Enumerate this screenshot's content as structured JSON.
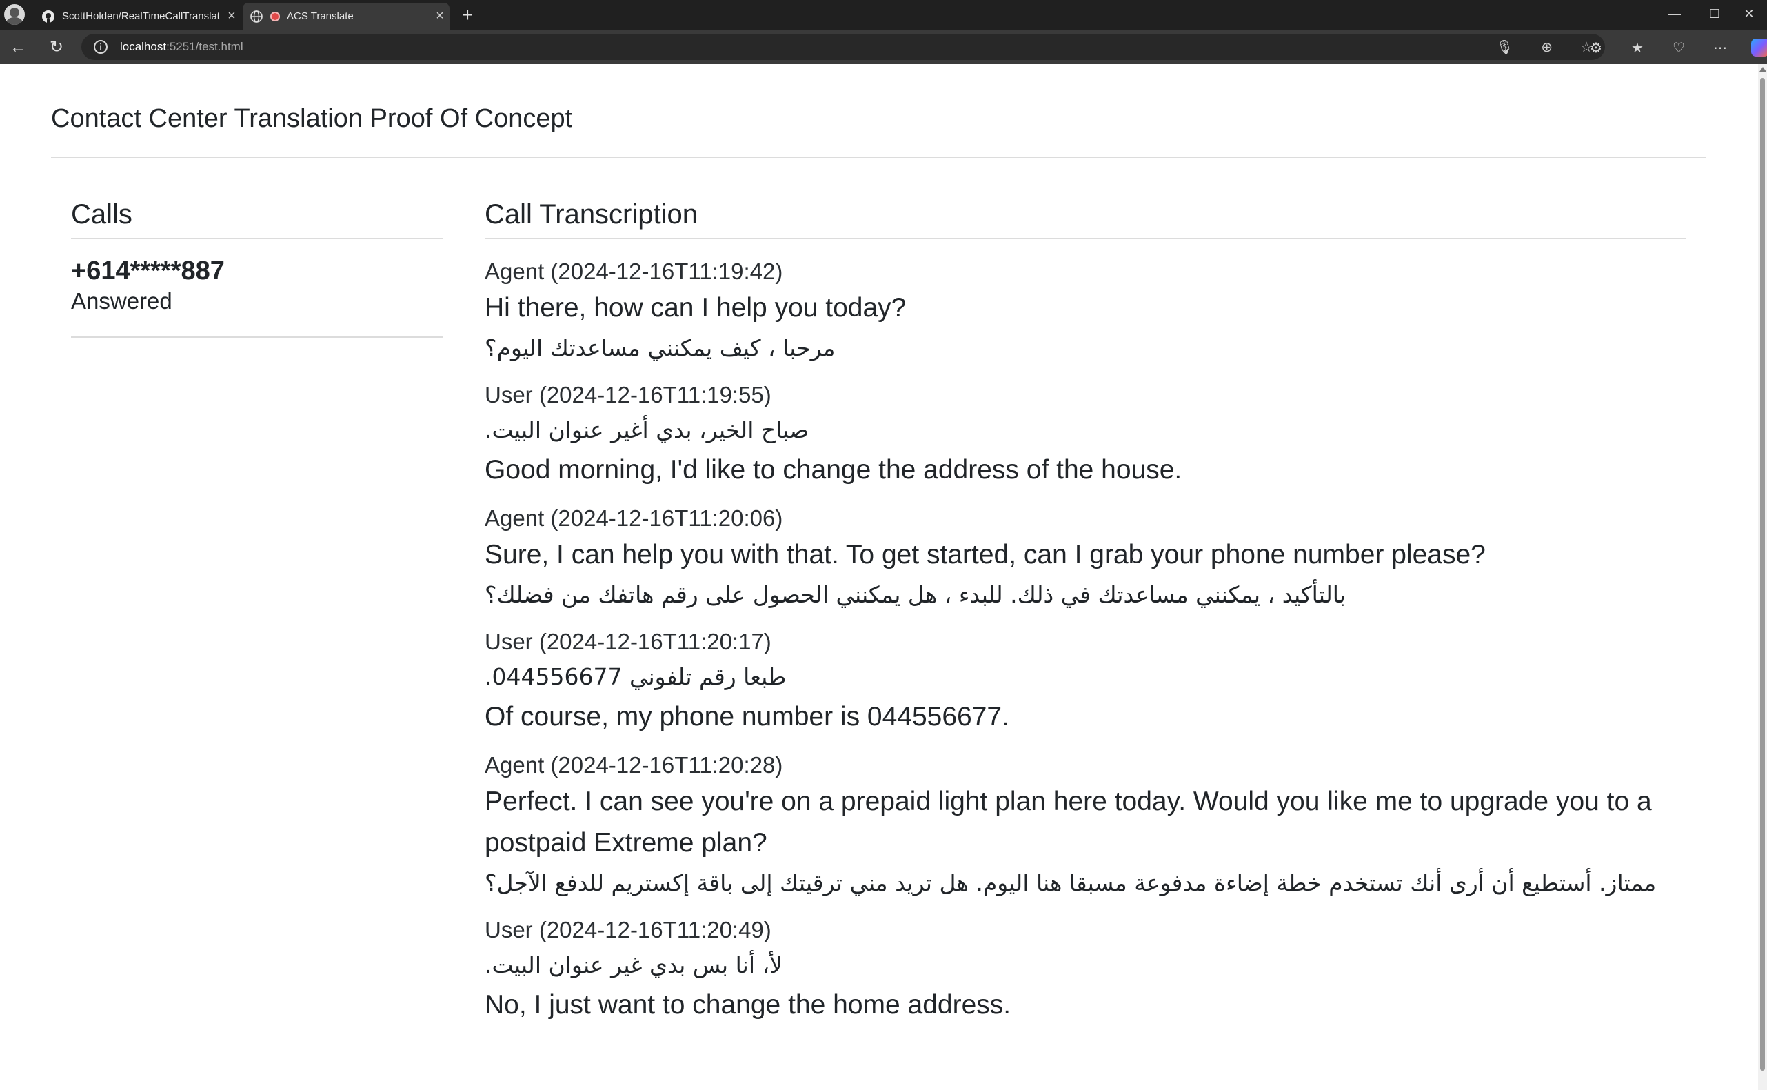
{
  "browser": {
    "tabs": [
      {
        "title": "ScottHolden/RealTimeCallTranslat",
        "icon": "github-icon",
        "active": false
      },
      {
        "title": "ACS Translate",
        "icon": "globe-icon",
        "active": true
      }
    ],
    "url_host": "localhost",
    "url_path": ":5251/test.html"
  },
  "page": {
    "title": "Contact Center Translation Proof Of Concept"
  },
  "calls": {
    "heading": "Calls",
    "items": [
      {
        "number": "+614*****887",
        "status": "Answered"
      }
    ]
  },
  "transcription": {
    "heading": "Call Transcription",
    "messages": [
      {
        "speaker": "Agent (2024-12-16T11:19:42)",
        "first": "Hi there, how can I help you today?",
        "second": "مرحبا ، كيف يمكنني مساعدتك اليوم؟"
      },
      {
        "speaker": "User (2024-12-16T11:19:55)",
        "first": "صباح الخير، بدي أغير عنوان البيت.",
        "second": "Good morning, I'd like to change the address of the house."
      },
      {
        "speaker": "Agent (2024-12-16T11:20:06)",
        "first": "Sure, I can help you with that. To get started, can I grab your phone number please?",
        "second": "بالتأكيد ، يمكنني مساعدتك في ذلك. للبدء ، هل يمكنني الحصول على رقم هاتفك من فضلك؟"
      },
      {
        "speaker": "User (2024-12-16T11:20:17)",
        "first": "طبعا رقم تلفوني 044556677.",
        "second": "Of course, my phone number is 044556677."
      },
      {
        "speaker": "Agent (2024-12-16T11:20:28)",
        "first": "Perfect. I can see you're on a prepaid light plan here today. Would you like me to upgrade you to a postpaid Extreme plan?",
        "second": "ممتاز. أستطيع أن أرى أنك تستخدم خطة إضاءة مدفوعة مسبقا هنا اليوم. هل تريد مني ترقيتك إلى باقة إكستريم للدفع الآجل؟"
      },
      {
        "speaker": "User (2024-12-16T11:20:49)",
        "first": "لأ، أنا بس بدي غير عنوان البيت.",
        "second": "No, I just want to change the home address."
      }
    ]
  }
}
